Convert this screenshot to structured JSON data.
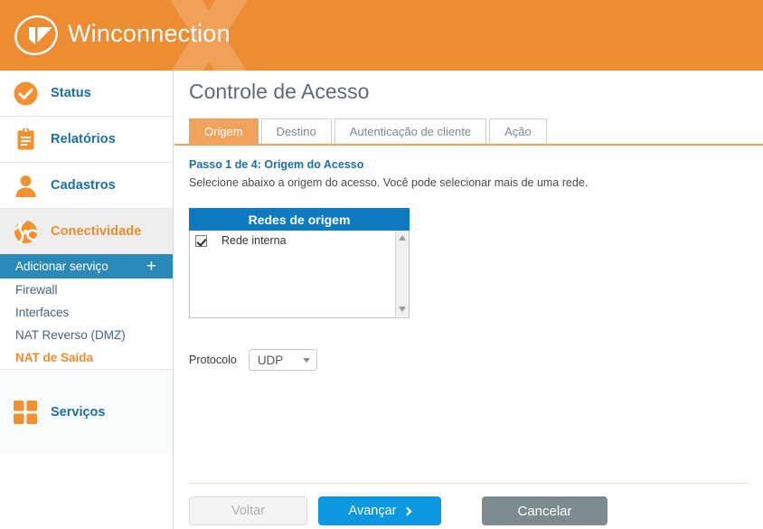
{
  "header": {
    "brand": "Winconnection",
    "logo_icon": "winconnection-logo-icon",
    "watermark": "X",
    "bg_color": "#ec8c33",
    "watermark_color": "#f0a057"
  },
  "sidebar": {
    "groups": [
      {
        "id": "status",
        "label": "Status",
        "icon": "check-circle-icon",
        "active": false
      },
      {
        "id": "relatorios",
        "label": "Relatórios",
        "icon": "clipboard-icon",
        "active": false
      },
      {
        "id": "cadastros",
        "label": "Cadastros",
        "icon": "user-icon",
        "active": false
      },
      {
        "id": "conectividade",
        "label": "Conectividade",
        "icon": "network-globe-icon",
        "active": true
      }
    ],
    "add_service": {
      "label": "Adicionar serviço",
      "plus": "+",
      "icon": "plus-icon"
    },
    "sub_items": [
      {
        "id": "firewall",
        "label": "Firewall",
        "selected": false
      },
      {
        "id": "interfaces",
        "label": "Interfaces",
        "selected": false
      },
      {
        "id": "nat-reverso",
        "label": "NAT Reverso (DMZ)",
        "selected": false
      },
      {
        "id": "nat-saida",
        "label": "NAT de Saida",
        "selected": true
      }
    ],
    "services": {
      "label": "Serviços",
      "icon": "grid-squares-icon"
    }
  },
  "main": {
    "title": "Controle de Acesso",
    "tabs": [
      {
        "id": "origem",
        "label": "Origem",
        "active": true
      },
      {
        "id": "destino",
        "label": "Destino",
        "active": false
      },
      {
        "id": "autenticacao",
        "label": "Autenticação de cliente",
        "active": false
      },
      {
        "id": "acao",
        "label": "Ação",
        "active": false
      }
    ],
    "step_title": "Passo 1 de 4: Origem do Acesso",
    "step_description": "Selecione abaixo a origem do acesso. Você pode selecionar mais de uma rede.",
    "networks_panel": {
      "header": "Redes de origem",
      "header_color": "#0e7ac0",
      "items": [
        {
          "id": "rede-interna",
          "label": "Rede interna",
          "checked": true
        }
      ]
    },
    "protocol": {
      "label": "Protocolo",
      "value": "UDP"
    },
    "buttons": {
      "back": "Voltar",
      "next": "Avançar",
      "cancel": "Cancelar",
      "next_color": "#0d97e0",
      "cancel_color": "#7d8b8f"
    }
  }
}
